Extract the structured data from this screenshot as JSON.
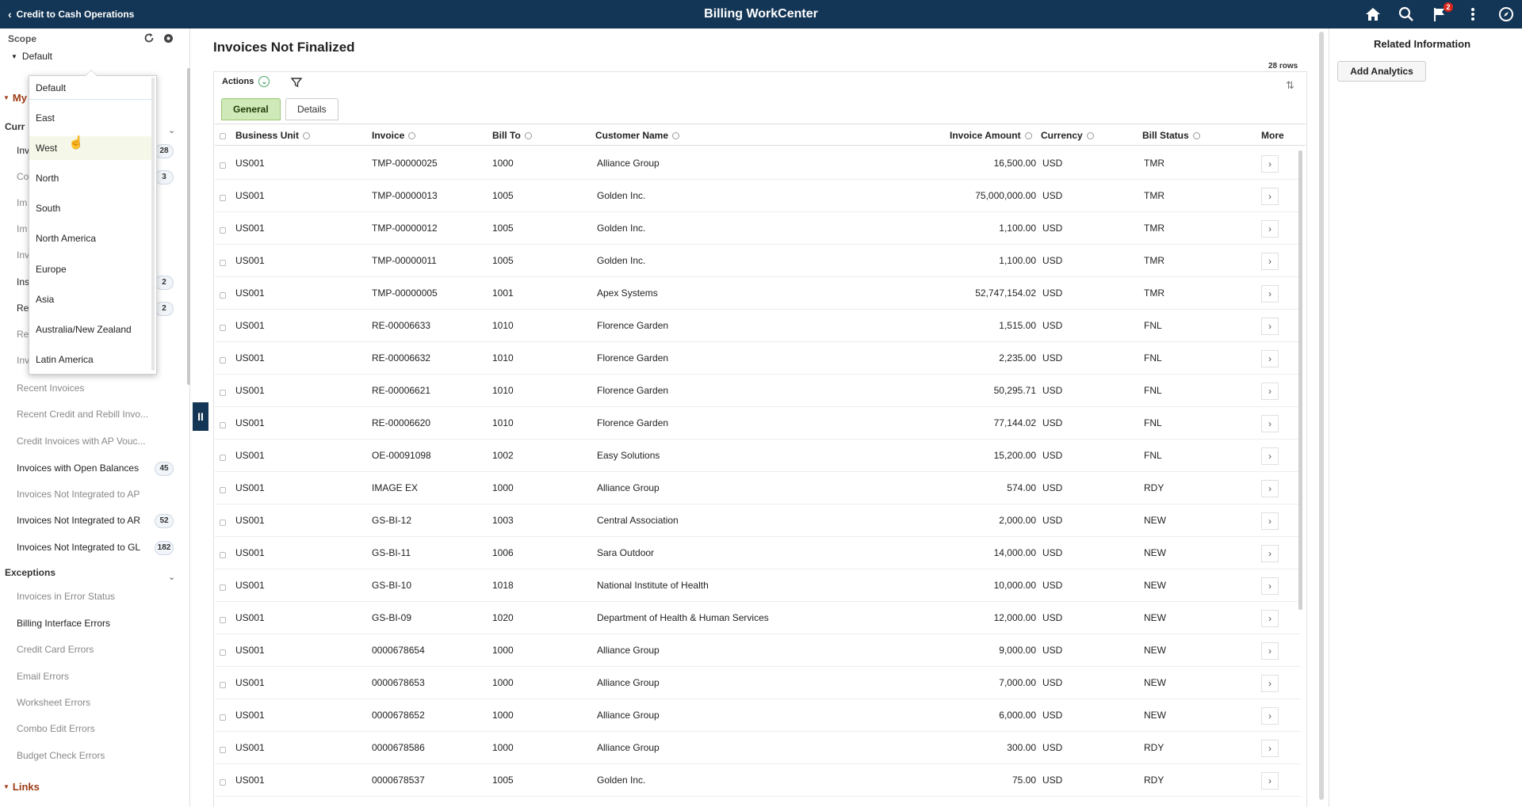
{
  "header": {
    "back_label": "Credit to Cash Operations",
    "title": "Billing WorkCenter",
    "notification_count": "2"
  },
  "scope": {
    "label": "Scope",
    "value": "Default",
    "options": [
      "Default",
      "East",
      "West",
      "North",
      "South",
      "North America",
      "Europe",
      "Asia",
      "Australia/New Zealand",
      "Latin America"
    ]
  },
  "left": {
    "my_work_label": "My",
    "current_label": "Curr",
    "partial_items": [
      {
        "label": "Inv",
        "count": "28"
      },
      {
        "label": "Co",
        "count": "3"
      },
      {
        "label": "Im",
        "count": ""
      },
      {
        "label": "Im",
        "count": ""
      },
      {
        "label": "Inv",
        "count": ""
      },
      {
        "label": "Ins",
        "count": "2"
      },
      {
        "label": "Re",
        "count": "2"
      },
      {
        "label": "Re",
        "count": ""
      },
      {
        "label": "Inv",
        "count": ""
      }
    ],
    "items": [
      {
        "label": "Recent Invoices",
        "count": ""
      },
      {
        "label": "Recent Credit and Rebill Invo...",
        "count": ""
      },
      {
        "label": "Credit Invoices with AP Vouc...",
        "count": ""
      },
      {
        "label": "Invoices with Open Balances",
        "count": "45"
      },
      {
        "label": "Invoices Not Integrated to AP",
        "count": ""
      },
      {
        "label": "Invoices Not Integrated to AR",
        "count": "52"
      },
      {
        "label": "Invoices Not Integrated to GL",
        "count": "182"
      }
    ],
    "exceptions_label": "Exceptions",
    "exceptions": [
      "Invoices in Error Status",
      "Billing Interface Errors",
      "Credit Card Errors",
      "Email Errors",
      "Worksheet Errors",
      "Combo Edit Errors",
      "Budget Check Errors"
    ],
    "links_label": "Links"
  },
  "main": {
    "title": "Invoices Not Finalized",
    "row_count": "28 rows",
    "actions_label": "Actions",
    "tabs": [
      "General",
      "Details"
    ],
    "columns": [
      "Business Unit",
      "Invoice",
      "Bill To",
      "Customer Name",
      "Invoice Amount",
      "Currency",
      "Bill Status",
      "More"
    ],
    "rows": [
      [
        "US001",
        "TMP-00000025",
        "1000",
        "Alliance Group",
        "16,500.00",
        "USD",
        "TMR"
      ],
      [
        "US001",
        "TMP-00000013",
        "1005",
        "Golden Inc.",
        "75,000,000.00",
        "USD",
        "TMR"
      ],
      [
        "US001",
        "TMP-00000012",
        "1005",
        "Golden Inc.",
        "1,100.00",
        "USD",
        "TMR"
      ],
      [
        "US001",
        "TMP-00000011",
        "1005",
        "Golden Inc.",
        "1,100.00",
        "USD",
        "TMR"
      ],
      [
        "US001",
        "TMP-00000005",
        "1001",
        "Apex Systems",
        "52,747,154.02",
        "USD",
        "TMR"
      ],
      [
        "US001",
        "RE-00006633",
        "1010",
        "Florence Garden",
        "1,515.00",
        "USD",
        "FNL"
      ],
      [
        "US001",
        "RE-00006632",
        "1010",
        "Florence Garden",
        "2,235.00",
        "USD",
        "FNL"
      ],
      [
        "US001",
        "RE-00006621",
        "1010",
        "Florence Garden",
        "50,295.71",
        "USD",
        "FNL"
      ],
      [
        "US001",
        "RE-00006620",
        "1010",
        "Florence Garden",
        "77,144.02",
        "USD",
        "FNL"
      ],
      [
        "US001",
        "OE-00091098",
        "1002",
        "Easy Solutions",
        "15,200.00",
        "USD",
        "FNL"
      ],
      [
        "US001",
        "IMAGE EX",
        "1000",
        "Alliance Group",
        "574.00",
        "USD",
        "RDY"
      ],
      [
        "US001",
        "GS-BI-12",
        "1003",
        "Central Association",
        "2,000.00",
        "USD",
        "NEW"
      ],
      [
        "US001",
        "GS-BI-11",
        "1006",
        "Sara Outdoor",
        "14,000.00",
        "USD",
        "NEW"
      ],
      [
        "US001",
        "GS-BI-10",
        "1018",
        "National Institute of Health",
        "10,000.00",
        "USD",
        "NEW"
      ],
      [
        "US001",
        "GS-BI-09",
        "1020",
        "Department of Health & Human Services",
        "12,000.00",
        "USD",
        "NEW"
      ],
      [
        "US001",
        "0000678654",
        "1000",
        "Alliance Group",
        "9,000.00",
        "USD",
        "NEW"
      ],
      [
        "US001",
        "0000678653",
        "1000",
        "Alliance Group",
        "7,000.00",
        "USD",
        "NEW"
      ],
      [
        "US001",
        "0000678652",
        "1000",
        "Alliance Group",
        "6,000.00",
        "USD",
        "NEW"
      ],
      [
        "US001",
        "0000678586",
        "1000",
        "Alliance Group",
        "300.00",
        "USD",
        "RDY"
      ],
      [
        "US001",
        "0000678537",
        "1005",
        "Golden Inc.",
        "75.00",
        "USD",
        "RDY"
      ]
    ]
  },
  "right": {
    "title": "Related Information",
    "button_label": "Add Analytics"
  },
  "colors": {
    "header_bg": "#143656",
    "accent_green": "#cfe9b8",
    "section_red": "#9c3a14"
  }
}
